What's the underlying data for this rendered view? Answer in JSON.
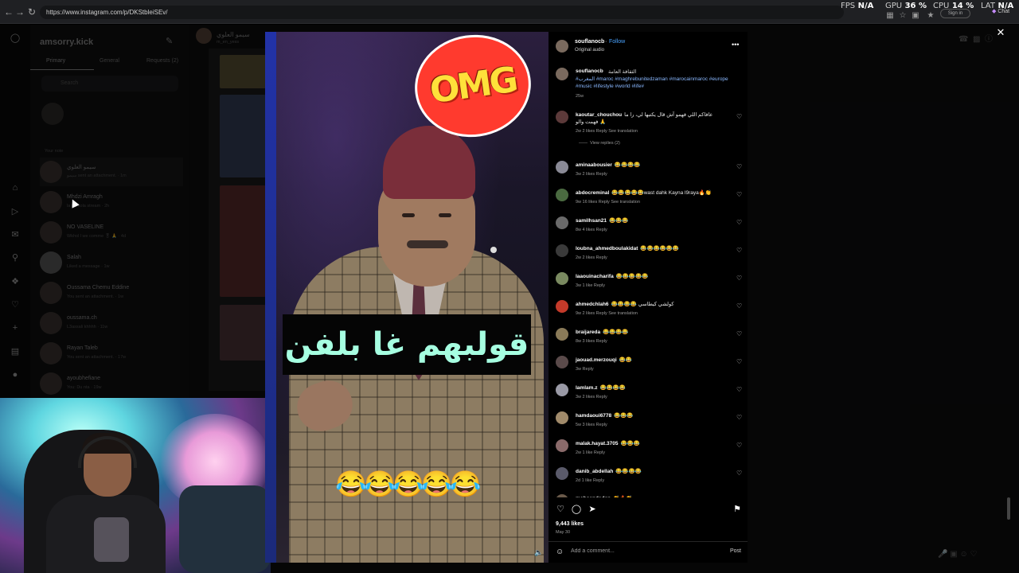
{
  "browser": {
    "url": "https://www.instagram.com/p/DKStbleiSEv/",
    "back_icon": "back-arrow-icon",
    "forward_icon": "forward-arrow-icon",
    "reload_icon": "reload-icon",
    "signin_label": "Sign in",
    "chat_label": "Chat",
    "overlay": {
      "fps_label": "FPS",
      "fps_value": "N/A",
      "gpu_label": "GPU",
      "gpu_value": "36 %",
      "cpu_label": "CPU",
      "cpu_value": "14 %",
      "lat_label": "LAT",
      "lat_value": "N/A"
    }
  },
  "dm_panel": {
    "username": "amsorry.kick",
    "tabs": [
      "Primary",
      "General",
      "Requests (2)"
    ],
    "search_placeholder": "Search",
    "your_note": "Your note",
    "threads": [
      {
        "name": "سيمو العلوي",
        "preview": "سيمو sent an attachment. · 1m"
      },
      {
        "name": "Mhdzi Amragh",
        "preview": "la tra kola stream · 2h"
      },
      {
        "name": "NO VASELINE",
        "preview": "Wkhol l we comme 🎖 🙏 · 4d"
      },
      {
        "name": "Salah",
        "preview": "Liked a message · 1w"
      },
      {
        "name": "Oussama Chemu Eddine",
        "preview": "You sent an attachment. · 1w"
      },
      {
        "name": "oussama.ch",
        "preview": "L3assali khhhh · 11w"
      },
      {
        "name": "Rayan Taleb",
        "preview": "You sent an attachment. · 17w"
      },
      {
        "name": "ayoubhefiane",
        "preview": "You: Du nta · 19w"
      }
    ]
  },
  "background_page": {
    "header_name": "سيمو العلوي",
    "header_handle": "m_en_yess"
  },
  "video": {
    "sticker_text": "OMG",
    "caption": "قولبهم غا بلفن",
    "emoji_row": "😂😂😂😂😂"
  },
  "post": {
    "author": "souflanocb",
    "follow_label": "Follow",
    "audio": "Original audio",
    "caption_user": "souflanocb",
    "caption_text": "الثقافة العامة",
    "caption_tags": "#المغرب #maroc #maghrebunitedzaman #marocainmaroc #europe #music #lifestyle #world #life#",
    "caption_age": "25w",
    "likes": "9,443 likes",
    "date": "May 30",
    "add_comment_placeholder": "Add a comment...",
    "post_label": "Post",
    "view_replies": "View replies (2)",
    "comments": [
      {
        "user": "kaoutar_chouchou",
        "text": "عافاكم اللي فهمو آش قال يكتبها لي، را ما فهمت والو 🙏",
        "meta": "2w   2 likes   Reply   See translation"
      },
      {
        "user": "aminaabousier",
        "text": "😂😂😂😂",
        "meta": "3w   2 likes   Reply"
      },
      {
        "user": "abdocreminal",
        "text": "😂😂😂😂😂wast dahk Kayna l9raya🔥👏",
        "meta": "9w   16 likes   Reply   See translation"
      },
      {
        "user": "samilhsan21",
        "text": "😂😂😂",
        "meta": "8w   4 likes   Reply"
      },
      {
        "user": "loubna_ahmedboulakidat",
        "text": "😂😂😂😂😂😂",
        "meta": "2w   2 likes   Reply"
      },
      {
        "user": "laaouinacharifa",
        "text": "😂😂😂😂😂",
        "meta": "3w   1 like   Reply"
      },
      {
        "user": "ahmedchlah6",
        "text": "😂😂😂😂 كولشي كيطاسي",
        "meta": "9w   2 likes   Reply   See translation"
      },
      {
        "user": "braijareda",
        "text": "😂😂😂😂",
        "meta": "8w   3 likes   Reply"
      },
      {
        "user": "jaouad.merzouqi",
        "text": "😂😂",
        "meta": "3w   Reply"
      },
      {
        "user": "lamlam.z",
        "text": "😂😂😂😂",
        "meta": "3w   2 likes   Reply"
      },
      {
        "user": "hamdaoui6778",
        "text": "😂😂😂",
        "meta": "5w   3 likes   Reply"
      },
      {
        "user": "malak.hayat.3705",
        "text": "😂😂😂",
        "meta": "2w   1 like   Reply"
      },
      {
        "user": "danib_abdellah",
        "text": "😂😂😂😂",
        "meta": "2d   1 like   Reply"
      },
      {
        "user": "mohsendaden",
        "text": "👏🔥👏",
        "meta": ""
      }
    ]
  },
  "colors": {
    "accent_link": "#4aa3ff",
    "caption_text_color": "#a6ffe1",
    "sticker_red": "#ff3a2e",
    "sticker_yellow": "#ffe13a"
  }
}
